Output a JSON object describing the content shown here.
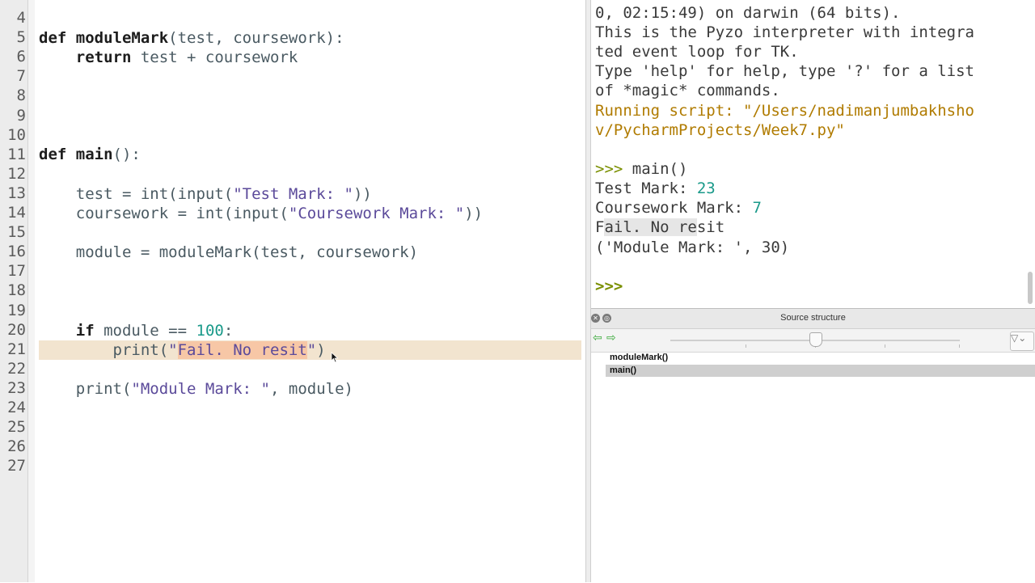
{
  "editor": {
    "line_numbers": [
      "4",
      "5",
      "6",
      "7",
      "8",
      "9",
      "10",
      "11",
      "12",
      "13",
      "14",
      "15",
      "16",
      "17",
      "18",
      "19",
      "20",
      "21",
      "22",
      "23",
      "24",
      "25",
      "26",
      "27"
    ],
    "line5": {
      "kw": "def",
      "fn": "moduleMark",
      "rest": "(test, coursework):"
    },
    "line6": {
      "kw": "return",
      "rest": "test + coursework"
    },
    "line11": {
      "kw": "def",
      "fn": "main",
      "rest": "():"
    },
    "line13": {
      "a": "test = int(input(",
      "s": "\"Test Mark: \"",
      "b": "))"
    },
    "line14": {
      "a": "coursework = int(input(",
      "s": "\"Coursework Mark: \"",
      "b": "))"
    },
    "line16": {
      "a": "module = moduleMark(test, coursework)"
    },
    "line20": {
      "kw": "if",
      "a": "module ==",
      "num": "100",
      "b": ":"
    },
    "line21": {
      "a": "print(",
      "q1": "\"",
      "sel": "Fail. No resit",
      "q2": "\"",
      "b": ")"
    },
    "line23": {
      "a": "print(",
      "s": "\"Module Mark: \"",
      "b": ", module)"
    }
  },
  "shell": {
    "l1": "0, 02:15:49) on darwin (64 bits).",
    "l2": "This is the Pyzo interpreter with integra",
    "l3": "ted event loop for TK.",
    "l4": "Type 'help' for help, type '?' for a list",
    "l5": "of *magic* commands.",
    "l6": "Running script: \"/Users/nadimanjumbakhsho",
    "l7": "v/PycharmProjects/Week7.py\"",
    "call_prompt": ">>>",
    "call": " main()",
    "test_label": "Test Mark: ",
    "test_value": "23",
    "cw_label": "Coursework Mark: ",
    "cw_value": "7",
    "out_a": "F",
    "out_b": "ail. No re",
    "out_c": "sit",
    "out_tuple": "('Module Mark: ', 30)",
    "final_prompt": ">>>"
  },
  "structure": {
    "title": "Source structure",
    "items": [
      {
        "label": "moduleMark()",
        "selected": false
      },
      {
        "label": "main()",
        "selected": true
      }
    ],
    "back_icon": "⇦",
    "forward_icon": "⇨",
    "filter_icon": "▽⌄"
  },
  "colors": {
    "current_line": "#f2e4cf",
    "selection": "#f7c7a6",
    "string": "#5b4a9a",
    "number": "#1a9a8a",
    "shell_orange": "#b07b00",
    "prompt_green": "#7a8f00"
  }
}
